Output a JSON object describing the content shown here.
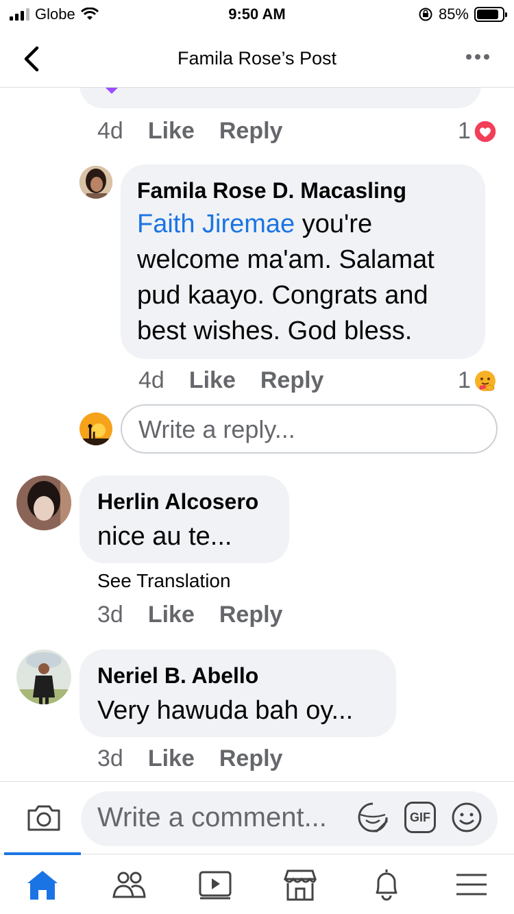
{
  "status_bar": {
    "carrier": "Globe",
    "time": "9:50 AM",
    "battery": "85%",
    "battery_level": 0.85
  },
  "header": {
    "title": "Famila Rose’s Post"
  },
  "previous_comment": {
    "time": "4d",
    "like": "Like",
    "reply": "Reply",
    "reaction_count": "1",
    "reaction": "love"
  },
  "reply": {
    "author": "Famila Rose D. Macasling",
    "mention": "Faith Jiremae",
    "text_line1": "you're",
    "text_line2": "welcome ma'am. Salamat",
    "text_line3": "pud kaayo. Congrats and",
    "text_line4": "best wishes. God bless.",
    "time": "4d",
    "like": "Like",
    "reply": "Reply",
    "reaction_count": "1",
    "reaction": "care"
  },
  "reply_input": {
    "placeholder": "Write a reply..."
  },
  "comments": [
    {
      "author": "Herlin Alcosero",
      "text": "nice au te...",
      "see_translation": "See Translation",
      "time": "3d",
      "like": "Like",
      "reply": "Reply"
    },
    {
      "author": "Neriel B. Abello",
      "text": "Very hawuda bah oy...",
      "time": "3d",
      "like": "Like",
      "reply": "Reply"
    }
  ],
  "comment_bar": {
    "placeholder": "Write a comment...",
    "gif": "GIF"
  },
  "tabs": [
    "home",
    "friends",
    "watch",
    "marketplace",
    "notifications",
    "menu"
  ],
  "colors": {
    "accent": "#1b74e4",
    "bubble": "#f0f2f5",
    "secondary_text": "#65676b",
    "love": "#f33e58"
  }
}
